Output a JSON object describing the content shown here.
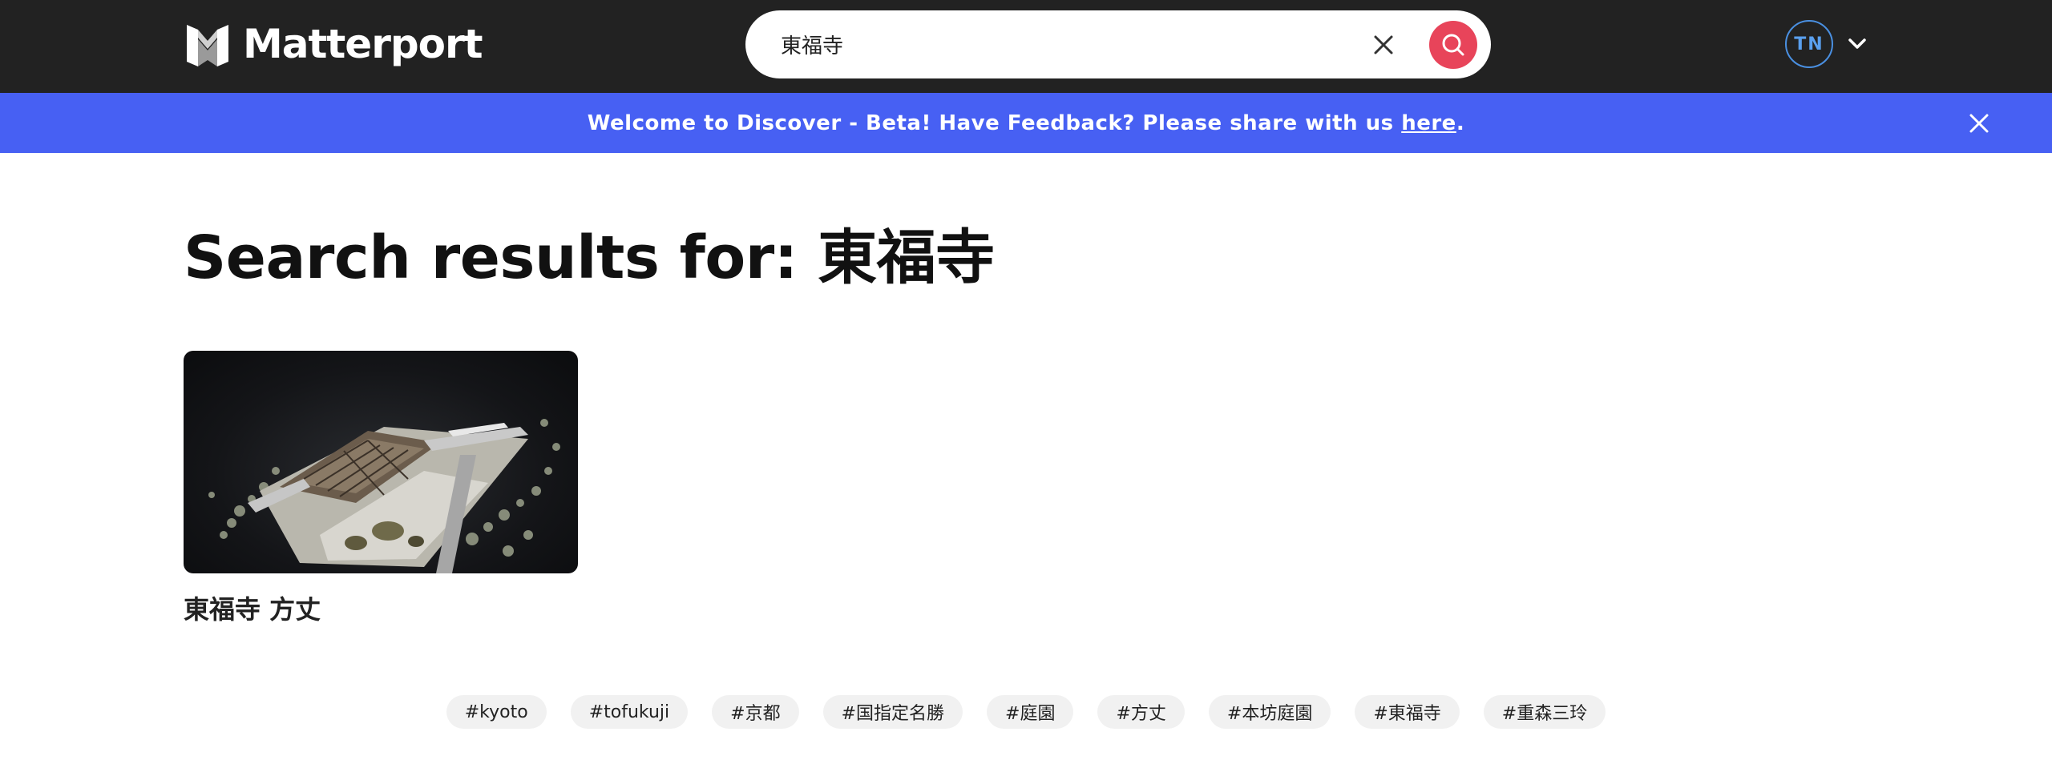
{
  "header": {
    "logo_text": "Matterport",
    "search": {
      "value": "東福寺",
      "placeholder": ""
    },
    "avatar_initials": "TN"
  },
  "banner": {
    "text_before": "Welcome to Discover - Beta! Have Feedback? Please share with us ",
    "link_text": "here",
    "text_after": "."
  },
  "main": {
    "results_title": "Search results for: 東福寺",
    "results": [
      {
        "title": "東福寺 方丈"
      }
    ],
    "tags": [
      "#kyoto",
      "#tofukuji",
      "#京都",
      "#国指定名勝",
      "#庭園",
      "#方丈",
      "#本坊庭園",
      "#東福寺",
      "#重森三玲"
    ]
  },
  "colors": {
    "header_bg": "#222222",
    "banner_bg": "#4760f3",
    "search_button": "#e8445a",
    "avatar_ring": "#4a90e2",
    "tag_bg": "#f1f1f1"
  },
  "icons": {
    "logo": "matterport-logo-icon",
    "clear": "close-icon",
    "search": "search-icon",
    "account_menu": "chevron-down-icon",
    "banner_close": "close-icon"
  }
}
